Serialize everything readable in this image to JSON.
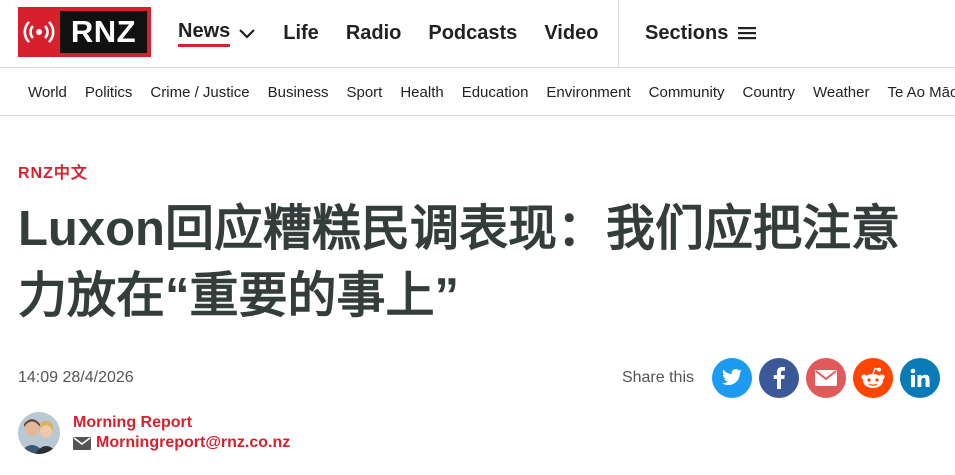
{
  "brand": {
    "name": "RNZ",
    "color": "#d7202e"
  },
  "main_nav": [
    {
      "label": "News",
      "active": true
    },
    {
      "label": "Life"
    },
    {
      "label": "Radio"
    },
    {
      "label": "Podcasts"
    },
    {
      "label": "Video"
    }
  ],
  "sections": {
    "label": "Sections",
    "icon": "hamburger-icon"
  },
  "sub_nav": [
    "World",
    "Politics",
    "Crime / Justice",
    "Business",
    "Sport",
    "Health",
    "Education",
    "Environment",
    "Community",
    "Country",
    "Weather",
    "Te Ao Māori"
  ],
  "article": {
    "kicker": "RNZ中文",
    "headline": "Luxon回应糟糕民调表现：我们应把注意力放在“重要的事上”",
    "timestamp": "14:09 28/4/2026"
  },
  "share": {
    "label": "Share this",
    "buttons": [
      {
        "name": "twitter",
        "icon": "twitter-icon",
        "color": "#1d9bf0"
      },
      {
        "name": "facebook",
        "icon": "facebook-icon",
        "color": "#3b5998"
      },
      {
        "name": "email",
        "icon": "email-icon",
        "color": "#e05a5a"
      },
      {
        "name": "reddit",
        "icon": "reddit-icon",
        "color": "#ff4500"
      },
      {
        "name": "linkedin",
        "icon": "linkedin-icon",
        "color": "#0a7bb6"
      }
    ]
  },
  "author": {
    "name": "Morning Report",
    "email": "Morningreport@rnz.co.nz"
  }
}
